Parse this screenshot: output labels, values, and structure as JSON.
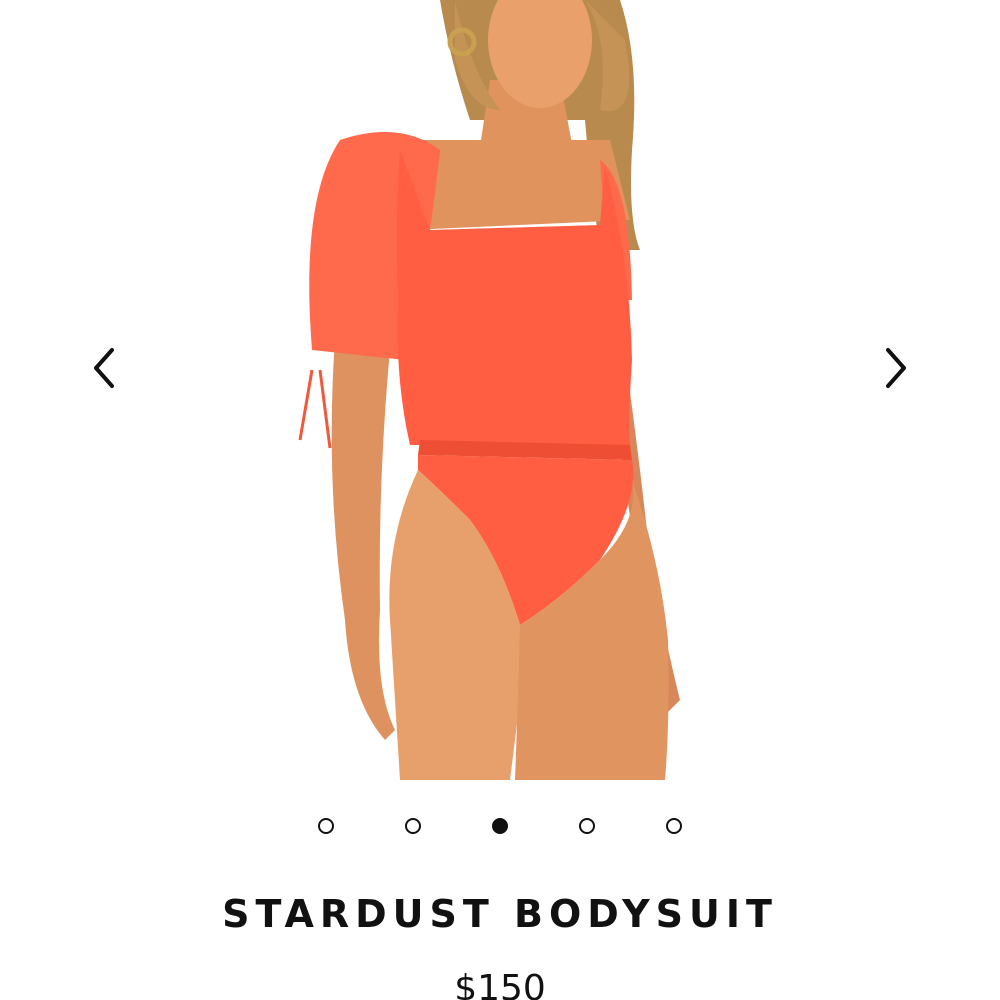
{
  "product": {
    "title": "STARDUST BODYSUIT",
    "price": "$150",
    "color": "#ff5a40"
  },
  "carousel": {
    "total_slides": 5,
    "active_slide": 3,
    "prev_icon": "chevron-left-icon",
    "next_icon": "chevron-right-icon"
  }
}
